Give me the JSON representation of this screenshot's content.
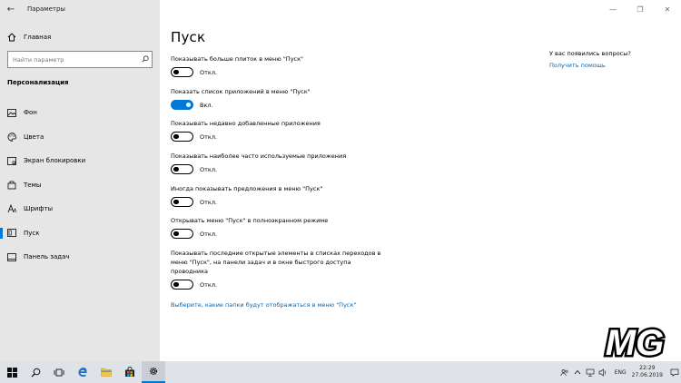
{
  "window": {
    "title": "Параметры",
    "back_glyph": "←",
    "minimize_glyph": "—",
    "maximize_glyph": "❐",
    "close_glyph": "✕"
  },
  "sidebar": {
    "home_label": "Главная",
    "search_placeholder": "Найти параметр",
    "section_title": "Персонализация",
    "items": [
      {
        "label": "Фон",
        "icon": "picture-icon"
      },
      {
        "label": "Цвета",
        "icon": "palette-icon"
      },
      {
        "label": "Экран блокировки",
        "icon": "lock-screen-icon"
      },
      {
        "label": "Темы",
        "icon": "brush-icon"
      },
      {
        "label": "Шрифты",
        "icon": "font-icon"
      },
      {
        "label": "Пуск",
        "icon": "start-icon",
        "active": true
      },
      {
        "label": "Панель задач",
        "icon": "taskbar-icon"
      }
    ]
  },
  "main": {
    "title": "Пуск",
    "settings": [
      {
        "label": "Показывать больше плиток в меню \"Пуск\"",
        "state": "Откл.",
        "on": false
      },
      {
        "label": "Показать список приложений в меню \"Пуск\"",
        "state": "Вкл.",
        "on": true
      },
      {
        "label": "Показывать недавно добавленные приложения",
        "state": "Откл.",
        "on": false
      },
      {
        "label": "Показывать наиболее часто используемые приложения",
        "state": "Откл.",
        "on": false
      },
      {
        "label": "Иногда показывать предложения в меню \"Пуск\"",
        "state": "Откл.",
        "on": false
      },
      {
        "label": "Открывать меню \"Пуск\" в полноэкранном режиме",
        "state": "Откл.",
        "on": false
      },
      {
        "label_lines": [
          "Показывать последние открытые элементы в списках переходов в",
          "меню \"Пуск\", на панели задач и в окне быстрого доступа",
          "проводника"
        ],
        "state": "Откл.",
        "on": false
      }
    ],
    "folders_link": "Выберите, какие папки будут отображаться в меню \"Пуск\""
  },
  "help": {
    "question": "У вас появились вопросы?",
    "link": "Получить помощь"
  },
  "watermark": {
    "text": "MG",
    "color": "#1e3a8a"
  },
  "taskbar": {
    "icons": [
      "windows-start-icon",
      "search-icon",
      "task-view-icon",
      "edge-icon",
      "file-explorer-icon",
      "store-icon",
      "settings-icon"
    ],
    "tray_icons": [
      "people-icon",
      "chevron-up-icon",
      "network-icon",
      "volume-icon"
    ],
    "language": "ENG",
    "time": "22:29",
    "date": "27.06.2019"
  },
  "colors": {
    "accent": "#0078d7",
    "link": "#0067b8",
    "sidebar_bg": "#e6e6e6"
  }
}
